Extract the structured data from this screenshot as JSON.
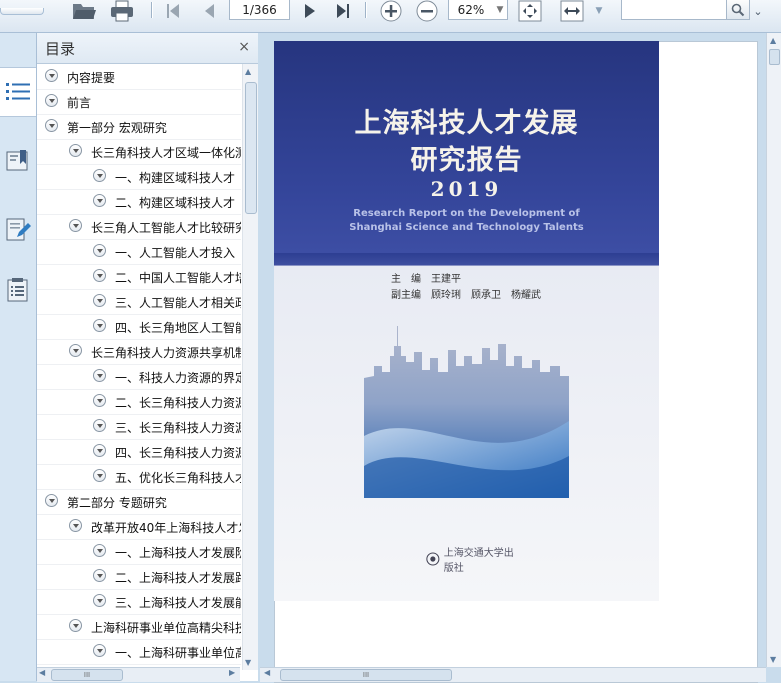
{
  "toolbar": {
    "page_value": "1/366",
    "zoom_value": "62%",
    "search_placeholder": ""
  },
  "toc": {
    "title": "目录",
    "close_glyph": "×",
    "items": [
      {
        "level": 0,
        "label": "内容提要"
      },
      {
        "level": 0,
        "label": "前言"
      },
      {
        "level": 0,
        "label": "第一部分 宏观研究"
      },
      {
        "level": 1,
        "label": "长三角科技人才区域一体化测"
      },
      {
        "level": 2,
        "label": "一、构建区域科技人才"
      },
      {
        "level": 2,
        "label": "二、构建区域科技人才"
      },
      {
        "level": 1,
        "label": "长三角人工智能人才比较研究"
      },
      {
        "level": 2,
        "label": "一、人工智能人才投入"
      },
      {
        "level": 2,
        "label": "二、中国人工智能人才培"
      },
      {
        "level": 2,
        "label": "三、人工智能人才相关政"
      },
      {
        "level": 2,
        "label": "四、长三角地区人工智能"
      },
      {
        "level": 1,
        "label": "长三角科技人力资源共享机制"
      },
      {
        "level": 2,
        "label": "一、科技人力资源的界定"
      },
      {
        "level": 2,
        "label": "二、长三角科技人力资源"
      },
      {
        "level": 2,
        "label": "三、长三角科技人力资源"
      },
      {
        "level": 2,
        "label": "四、长三角科技人力资源"
      },
      {
        "level": 2,
        "label": "五、优化长三角科技人才"
      },
      {
        "level": 0,
        "label": "第二部分 专题研究"
      },
      {
        "level": 1,
        "label": "改革开放40年上海科技人才发"
      },
      {
        "level": 2,
        "label": "一、上海科技人才发展阶"
      },
      {
        "level": 2,
        "label": "二、上海科技人才发展路"
      },
      {
        "level": 2,
        "label": "三、上海科技人才发展能"
      },
      {
        "level": 1,
        "label": "上海科研事业单位高精尖科技"
      },
      {
        "level": 2,
        "label": "一、上海科研事业单位高"
      }
    ]
  },
  "cover": {
    "title_line1": "上海科技人才发展",
    "title_line2": "研究报告",
    "year": "2019",
    "en_line1": "Research Report on the Development of",
    "en_line2": "Shanghai Science and Technology Talents",
    "editor_line": "主　编　王建平",
    "deputy_line": "副主编　顾玲琍　顾承卫　杨耀武",
    "publisher": "上海交通大学出版社"
  },
  "colors": {
    "cover_blue": "#2e3f93",
    "ui_bg": "#c9dcec"
  }
}
